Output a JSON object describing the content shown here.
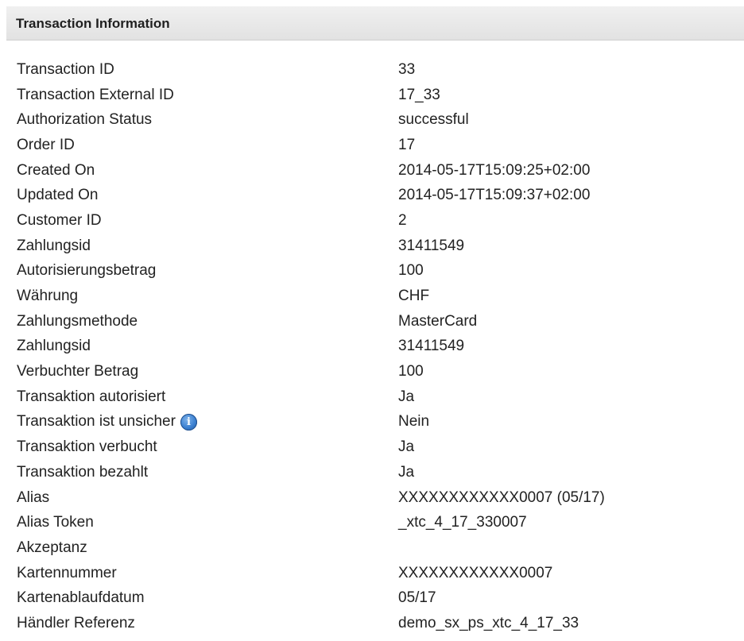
{
  "panel": {
    "title": "Transaction Information"
  },
  "info_icon_glyph": "i",
  "rows": [
    {
      "label": "Transaction ID",
      "value": "33"
    },
    {
      "label": "Transaction External ID",
      "value": "17_33"
    },
    {
      "label": "Authorization Status",
      "value": "successful"
    },
    {
      "label": "Order ID",
      "value": "17"
    },
    {
      "label": "Created On",
      "value": "2014-05-17T15:09:25+02:00"
    },
    {
      "label": "Updated On",
      "value": "2014-05-17T15:09:37+02:00"
    },
    {
      "label": "Customer ID",
      "value": "2"
    },
    {
      "label": "Zahlungsid",
      "value": "31411549"
    },
    {
      "label": "Autorisierungsbetrag",
      "value": "100"
    },
    {
      "label": "Währung",
      "value": "CHF"
    },
    {
      "label": "Zahlungsmethode",
      "value": "MasterCard"
    },
    {
      "label": "Zahlungsid",
      "value": "31411549"
    },
    {
      "label": "Verbuchter Betrag",
      "value": "100"
    },
    {
      "label": "Transaktion autorisiert",
      "value": "Ja"
    },
    {
      "label": "Transaktion ist unsicher",
      "value": "Nein"
    },
    {
      "label": "Transaktion verbucht",
      "value": "Ja"
    },
    {
      "label": "Transaktion bezahlt",
      "value": "Ja"
    },
    {
      "label": "Alias",
      "value": "XXXXXXXXXXXX0007 (05/17)"
    },
    {
      "label": "Alias Token",
      "value": "_xtc_4_17_330007"
    },
    {
      "label": "Akzeptanz",
      "value": ""
    },
    {
      "label": "Kartennummer",
      "value": "XXXXXXXXXXXX0007"
    },
    {
      "label": "Kartenablaufdatum",
      "value": "05/17"
    },
    {
      "label": "Händler Referenz",
      "value": "demo_sx_ps_xtc_4_17_33"
    }
  ]
}
